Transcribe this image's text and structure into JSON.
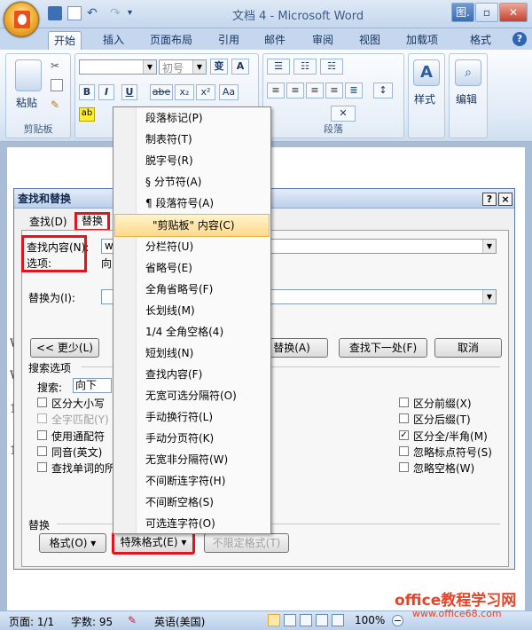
{
  "window": {
    "title": "文档 4 - Microsoft Word",
    "help_label": "?"
  },
  "ribbon_tabs": [
    "开始",
    "插入",
    "页面布局",
    "引用",
    "邮件",
    "审阅",
    "视图",
    "加载项",
    "格式"
  ],
  "ribbon": {
    "clipboard_group": "剪贴板",
    "paste_label": "粘贴",
    "font_size_value": "初号",
    "paragraph_group": "段落",
    "styles_label": "样式",
    "edit_label": "编辑",
    "font_buttons": [
      "B",
      "I",
      "U",
      "abe",
      "x₂",
      "x²"
    ],
    "a_label": "A",
    "change_case_label": "Aa"
  },
  "dialog": {
    "title": "查找和替换",
    "help_btn": "?",
    "close_btn": "×",
    "tabs": [
      "查找(D)",
      "替换"
    ],
    "find_label": "查找内容(N):",
    "find_value": "w",
    "options_label": "选项:",
    "options_value": "向",
    "replace_label": "替换为(I):",
    "less_button": "<< 更少(L)",
    "replace_button": "替换(A)",
    "find_next_button": "查找下一处(F)",
    "cancel_button": "取消",
    "search_options_title": "搜索选项",
    "search_label": "搜索:",
    "search_value": "向下",
    "left_options": [
      {
        "label": "区分大小写",
        "checked": false,
        "disabled": false
      },
      {
        "label": "全字匹配(Y)",
        "checked": false,
        "disabled": true
      },
      {
        "label": "使用通配符",
        "checked": false,
        "disabled": false
      },
      {
        "label": "同音(英文)",
        "checked": false,
        "disabled": false
      },
      {
        "label": "查找单词的所",
        "checked": false,
        "disabled": false
      }
    ],
    "right_options": [
      {
        "label": "区分前缀(X)",
        "checked": false
      },
      {
        "label": "区分后缀(T)",
        "checked": false
      },
      {
        "label": "区分全/半角(M)",
        "checked": true
      },
      {
        "label": "忽略标点符号(S)",
        "checked": false
      },
      {
        "label": "忽略空格(W)",
        "checked": false
      }
    ],
    "replace_section": "替换",
    "format_button": "格式(O) ▾",
    "special_button": "特殊格式(E) ▾",
    "no_format_button": "不限定格式(T)"
  },
  "special_menu": {
    "items": [
      "段落标记(P)",
      "制表符(T)",
      "脱字号(R)",
      "§ 分节符(A)",
      "¶ 段落符号(A)",
      "\"剪贴板\" 内容(C)",
      "分栏符(U)",
      "省略号(E)",
      "全角省略号(F)",
      "长划线(M)",
      "1/4 全角空格(4)",
      "短划线(N)",
      "查找内容(F)",
      "无宽可选分隔符(O)",
      "手动换行符(L)",
      "手动分页符(K)",
      "无宽非分隔符(W)",
      "不间断连字符(H)",
      "不间断空格(S)",
      "可选连字符(O)"
    ],
    "highlighted_index": 5
  },
  "status_bar": {
    "page": "页面: 1/1",
    "words": "字数: 95",
    "language": "英语(美国)",
    "zoom": "100%"
  },
  "watermark": {
    "line1": "office教程学习网",
    "line2": "www.office68.com"
  },
  "doc_peek": {
    "left_chars": [
      "W",
      "W",
      "1",
      "1"
    ]
  },
  "colors": {
    "highlight_box": "#e3141c",
    "menu_highlight": "#ffd98a"
  }
}
